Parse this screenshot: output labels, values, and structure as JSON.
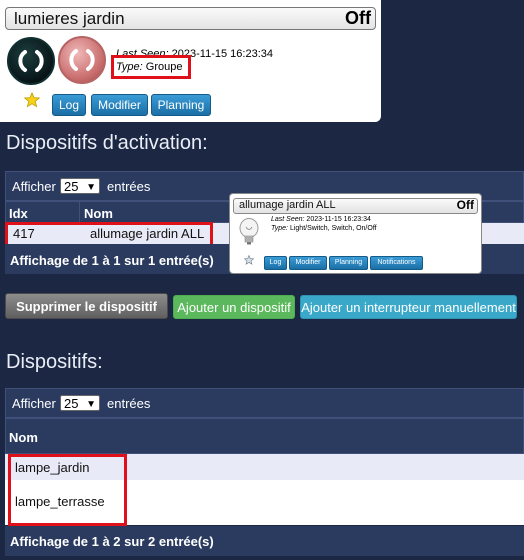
{
  "device_card": {
    "name": "lumieres jardin",
    "state": "Off",
    "last_seen_label": "Last Seen:",
    "last_seen_value": "2023-11-15 16:23:34",
    "type_label": "Type:",
    "type_value": "Groupe",
    "buttons": {
      "log": "Log",
      "modify": "Modifier",
      "planning": "Planning"
    }
  },
  "activation": {
    "heading": "Dispositifs d'activation:",
    "show_label": "Afficher",
    "page_size": "25",
    "entries_label": "entrées",
    "columns": {
      "idx": "Idx",
      "name": "Nom"
    },
    "rows": [
      {
        "idx": "417",
        "name": "allumage jardin ALL"
      }
    ],
    "footer": "Affichage de 1 à 1 sur 1 entrée(s)"
  },
  "actions": {
    "delete": "Supprimer le dispositif",
    "add_device": "Ajouter un dispositif",
    "add_manual": "Ajouter un interrupteur manuellement"
  },
  "popup": {
    "name": "allumage jardin ALL",
    "state": "Off",
    "last_seen_label": "Last Seen:",
    "last_seen_value": "2023-11-15 16:23:34",
    "type_label": "Type:",
    "type_value": "Light/Switch, Switch, On/Off",
    "buttons": {
      "log": "Log",
      "modify": "Modifier",
      "planning": "Planning",
      "notifications": "Notifications"
    }
  },
  "devices": {
    "heading": "Dispositifs:",
    "show_label": "Afficher",
    "page_size": "25",
    "entries_label": "entrées",
    "columns": {
      "name": "Nom"
    },
    "rows": [
      {
        "name": "lampe_jardin"
      },
      {
        "name": "lampe_terrasse"
      }
    ],
    "footer": "Affichage de 1 à 2 sur 2 entrée(s)"
  },
  "colors": {
    "background": "#1b2743",
    "highlight_box": "#e0101a",
    "pill_blue": "#1b6fa6",
    "green_button": "#5cb85c",
    "teal_button": "#3aa8c9"
  }
}
